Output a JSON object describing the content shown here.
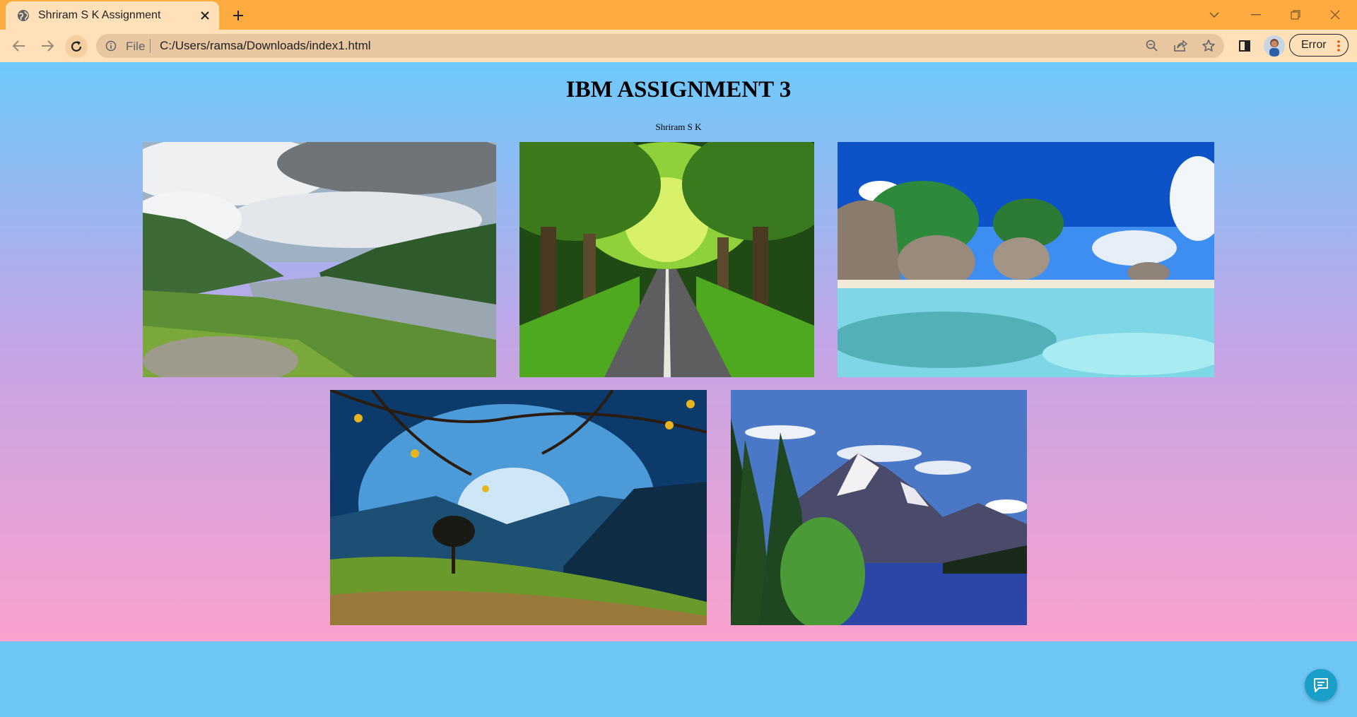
{
  "browser": {
    "tab": {
      "title": "Shriram S K Assignment"
    },
    "omnibox": {
      "scheme": "File",
      "url": "C:/Users/ramsa/Downloads/index1.html"
    },
    "profile": {
      "status_label": "Error"
    },
    "colors": {
      "tabstrip": "#ffab40",
      "toolbar": "#ffe0b8"
    }
  },
  "page": {
    "title": "IBM ASSIGNMENT 3",
    "subtitle": "Shriram S K",
    "images": [
      {
        "name": "scottish-loch-valley"
      },
      {
        "name": "tree-tunnel-road"
      },
      {
        "name": "tropical-beach-rocks"
      },
      {
        "name": "autumn-tree-valley"
      },
      {
        "name": "snowy-mountain-lake"
      }
    ],
    "colors": {
      "gradient_top": "#6ec9fb",
      "gradient_bottom": "#fba1cd"
    }
  },
  "icons": [
    "globe-icon",
    "close-icon",
    "plus-icon",
    "chevron-down-icon",
    "minimize-icon",
    "restore-icon",
    "back-arrow-icon",
    "forward-arrow-icon",
    "reload-icon",
    "info-icon",
    "zoom-out-icon",
    "share-icon",
    "star-icon",
    "side-panel-icon",
    "more-vertical-icon",
    "chat-icon"
  ]
}
